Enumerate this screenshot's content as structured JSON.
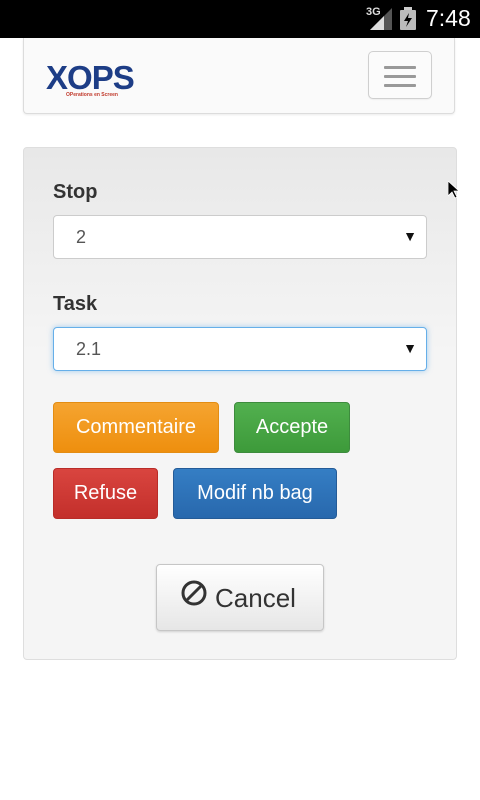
{
  "status_bar": {
    "network": "3G",
    "time": "7:48",
    "icons": [
      "signal-icon",
      "battery-icon"
    ]
  },
  "navbar": {
    "logo_text_x": "X",
    "logo_text_o": "O",
    "logo_text_ps": "PS",
    "logo_tagline": "OPerations en Screen",
    "menu_icon": "hamburger-menu-icon"
  },
  "form": {
    "stop": {
      "label": "Stop",
      "value": "2"
    },
    "task": {
      "label": "Task",
      "value": "2.1"
    },
    "buttons": {
      "commentaire": "Commentaire",
      "accepte": "Accepte",
      "refuse": "Refuse",
      "modif_nb_bag": "Modif nb bag",
      "cancel": "Cancel"
    },
    "cancel_icon": "ban-icon"
  },
  "colors": {
    "warning": "#f0a020",
    "success": "#47a447",
    "danger": "#d2322d",
    "primary": "#3071a9",
    "focus": "#66afe9"
  }
}
